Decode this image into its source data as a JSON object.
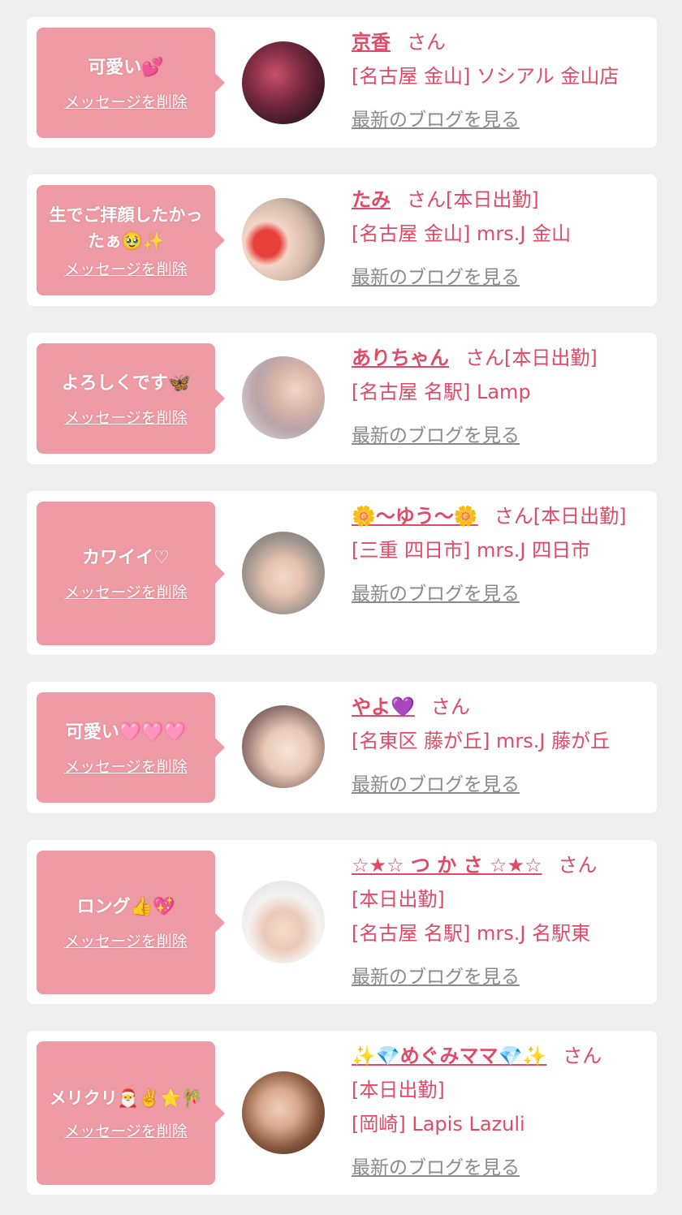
{
  "cards": [
    {
      "message": "可愛い💕",
      "delete_label": "メッセージを削除",
      "name": "京香",
      "suffix": "さん",
      "shop": "[名古屋 金山] ソシアル 金山店",
      "blog_label": "最新のブログを見る"
    },
    {
      "message": "生でご拝顔したかったぁ🥹✨",
      "delete_label": "メッセージを削除",
      "name": "たみ",
      "suffix": "さん[本日出勤]",
      "shop": "[名古屋 金山] mrs.J 金山",
      "blog_label": "最新のブログを見る"
    },
    {
      "message": "よろしくです🦋",
      "delete_label": "メッセージを削除",
      "name": "ありちゃん",
      "suffix": "さん[本日出勤]",
      "shop": "[名古屋 名駅] Lamp",
      "blog_label": "最新のブログを見る"
    },
    {
      "message": "カワイイ♡",
      "delete_label": "メッセージを削除",
      "name": "🌼〜ゆう〜🌼",
      "suffix": "さん[本日出勤]",
      "shop": "[三重 四日市] mrs.J 四日市",
      "blog_label": "最新のブログを見る"
    },
    {
      "message": "可愛い🩷🩷🩷",
      "delete_label": "メッセージを削除",
      "name": "やよ💜",
      "suffix": "さん",
      "shop": "[名東区 藤が丘] mrs.J 藤が丘",
      "blog_label": "最新のブログを見る"
    },
    {
      "message": "ロング👍💖",
      "delete_label": "メッセージを削除",
      "name": "☆★☆ つ か さ ☆★☆",
      "suffix": "さん",
      "status": "[本日出勤]",
      "shop": "[名古屋 名駅] mrs.J 名駅東",
      "blog_label": "最新のブログを見る"
    },
    {
      "message": "メリクリ🎅✌️⭐️🎋",
      "delete_label": "メッセージを削除",
      "name": "✨💎めぐみママ💎✨",
      "suffix": "さん",
      "status": "[本日出勤]",
      "shop": "[岡崎] Lapis Lazuli",
      "blog_label": "最新のブログを見る"
    }
  ],
  "colors": {
    "background": "#efefef",
    "card": "#ffffff",
    "bubble": "#ef9ba5",
    "accent": "#e04a66",
    "link_gray": "#8a8a8a"
  }
}
